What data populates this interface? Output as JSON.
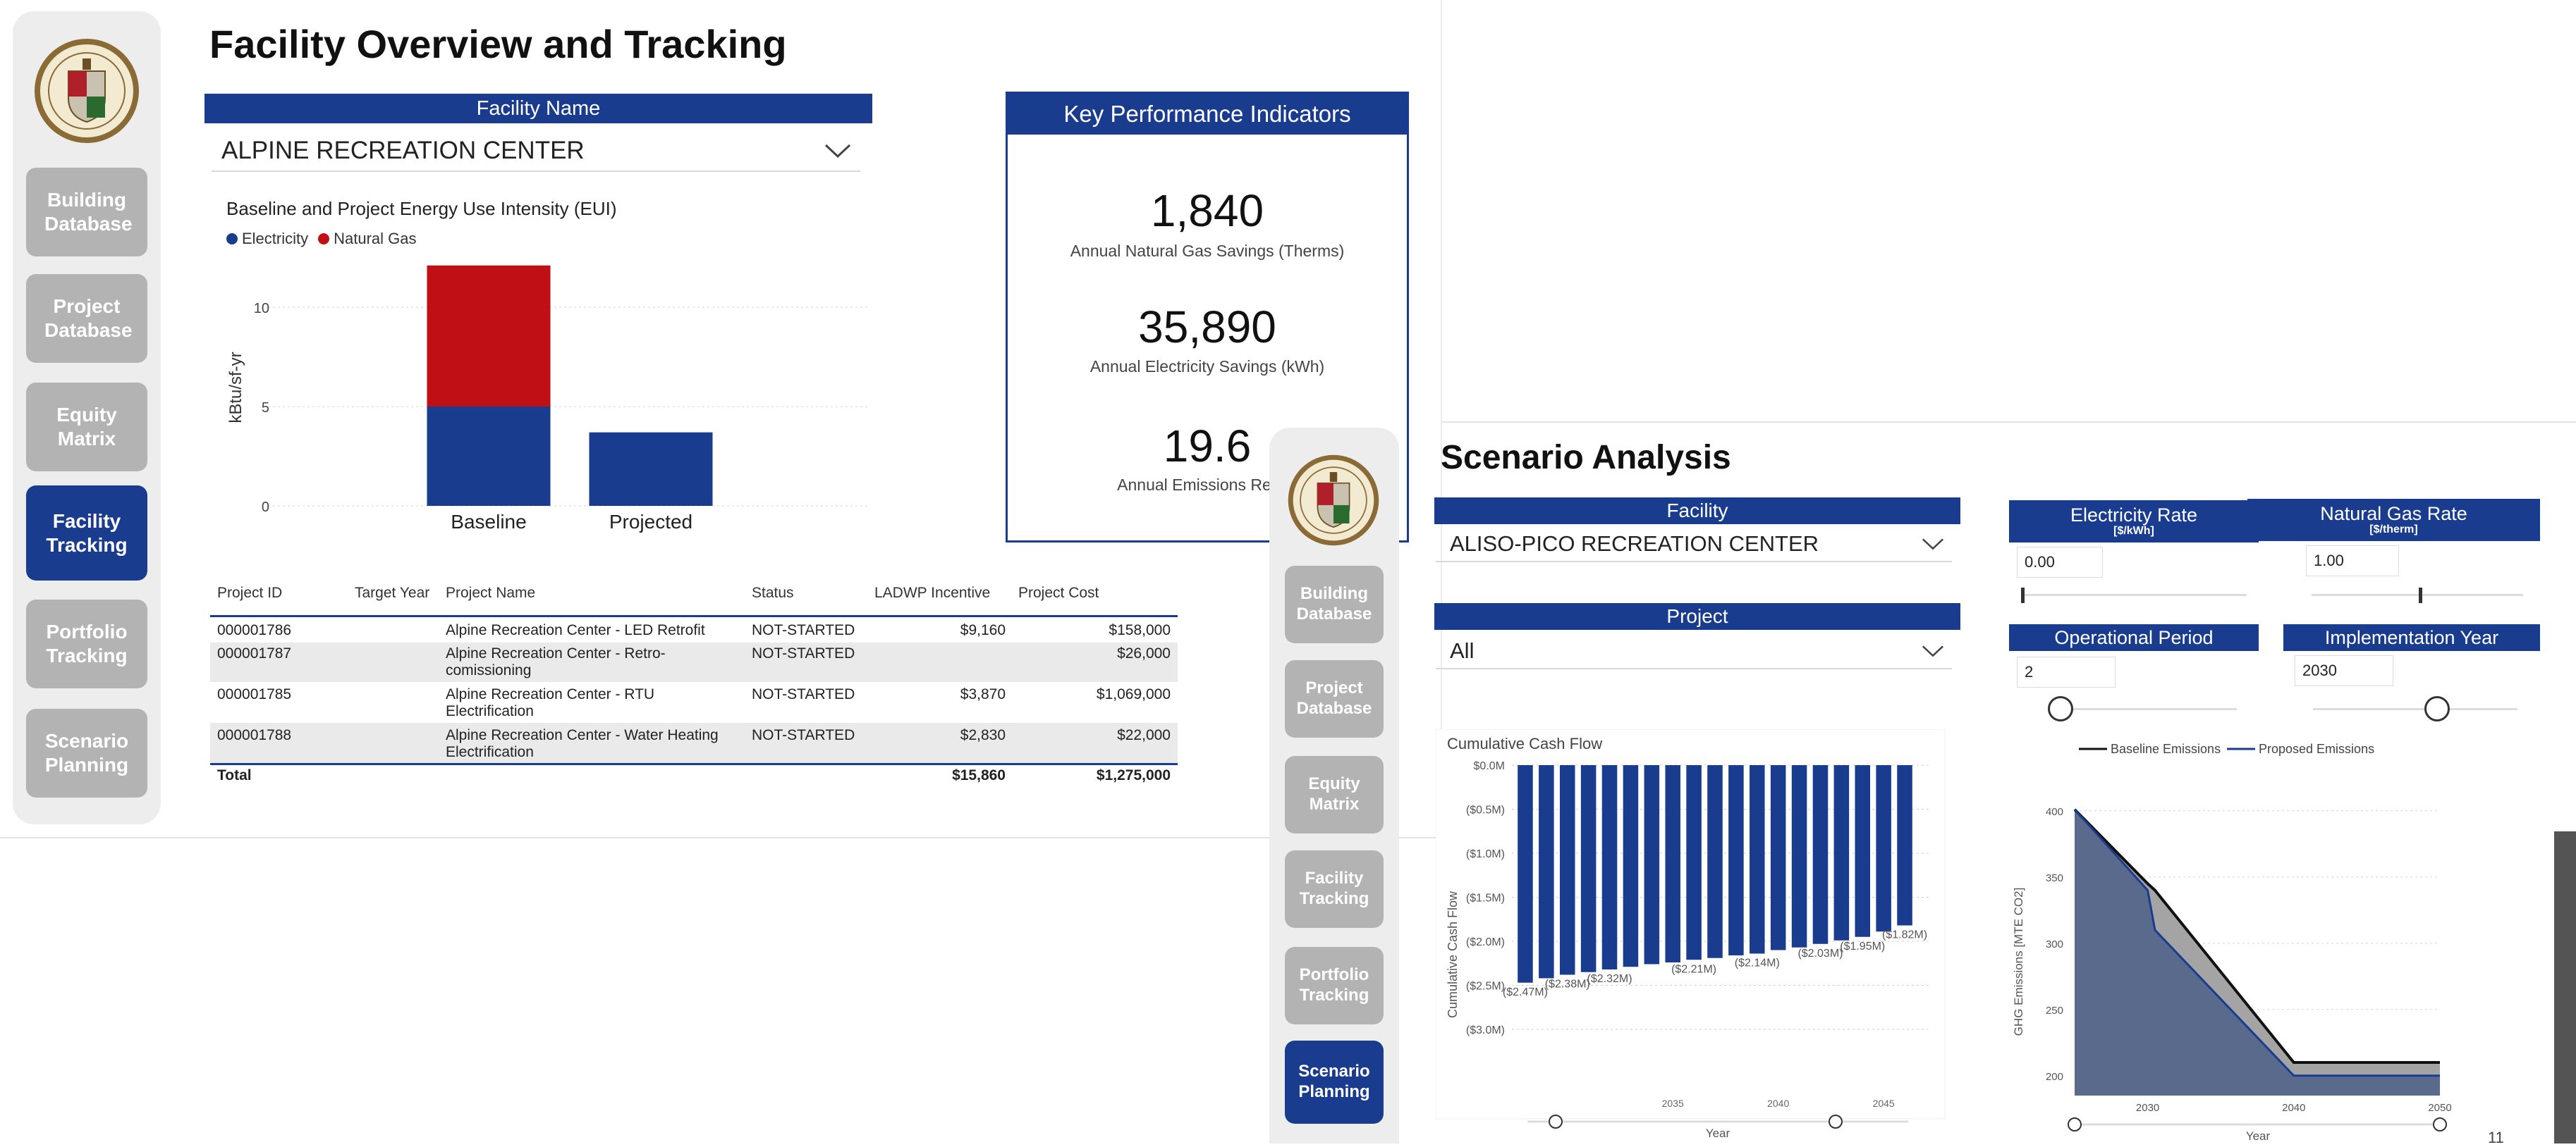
{
  "left": {
    "title": "Facility Overview and Tracking",
    "nav": [
      "Building Database",
      "Project Database",
      "Equity Matrix",
      "Facility Tracking",
      "Portfolio Tracking",
      "Scenario Planning"
    ],
    "facility_header": "Facility Name",
    "facility_value": "ALPINE RECREATION CENTER",
    "eui": {
      "title": "Baseline and Project Energy Use Intensity (EUI)",
      "legend": [
        "Electricity",
        "Natural Gas"
      ],
      "ylabel": "kBtu/sf-yr",
      "yticks": [
        "10",
        "5",
        "0"
      ]
    },
    "kpi": {
      "header": "Key Performance Indicators",
      "items": [
        {
          "value": "1,840",
          "label": "Annual Natural Gas Savings (Therms)"
        },
        {
          "value": "35,890",
          "label": "Annual Electricity Savings (kWh)"
        },
        {
          "value": "19.6",
          "label": "Annual Emissions Reduc"
        }
      ]
    },
    "table": {
      "headers": [
        "Project ID",
        "Target Year",
        "Project Name",
        "Status",
        "LADWP Incentive",
        "Project Cost"
      ],
      "rows": [
        [
          "000001786",
          "",
          "Alpine Recreation Center - LED Retrofit",
          "NOT-STARTED",
          "$9,160",
          "$158,000"
        ],
        [
          "000001787",
          "",
          "Alpine Recreation Center - Retro-comissioning",
          "NOT-STARTED",
          "",
          "$26,000"
        ],
        [
          "000001785",
          "",
          "Alpine Recreation Center - RTU Electrification",
          "NOT-STARTED",
          "$3,870",
          "$1,069,000"
        ],
        [
          "000001788",
          "",
          "Alpine Recreation Center - Water Heating Electrification",
          "NOT-STARTED",
          "$2,830",
          "$22,000"
        ]
      ],
      "total": {
        "label": "Total",
        "incentive": "$15,860",
        "cost": "$1,275,000"
      }
    }
  },
  "right": {
    "title": "Scenario Analysis",
    "nav": [
      "Building Database",
      "Project Database",
      "Equity Matrix",
      "Facility Tracking",
      "Portfolio Tracking",
      "Scenario Planning"
    ],
    "facility_header": "Facility",
    "facility_value": "ALISO-PICO RECREATION CENTER",
    "project_header": "Project",
    "project_value": "All",
    "electricity_rate": {
      "label": "Electricity Rate",
      "unit": "[$/kWh]",
      "value": "0.00"
    },
    "gas_rate": {
      "label": "Natural Gas Rate",
      "unit": "[$/therm]",
      "value": "1.00"
    },
    "operational_period": {
      "label": "Operational Period",
      "value": "2"
    },
    "implementation_year": {
      "label": "Implementation Year",
      "value": "2030"
    },
    "page_number": "11"
  },
  "colors": {
    "blue": "#1a3c8f",
    "red": "#c00f15",
    "nav_gray": "#b3b3b3",
    "baseline_line": "#111111",
    "emission_fill": "#5a6a8d"
  },
  "chart_data": [
    {
      "type": "bar",
      "title": "Baseline and Project Energy Use Intensity (EUI)",
      "ylabel": "kBtu/sf-yr",
      "categories": [
        "Baseline",
        "Projected"
      ],
      "series": [
        {
          "name": "Electricity",
          "values": [
            5.0,
            3.7
          ]
        },
        {
          "name": "Natural Gas",
          "values": [
            7.1,
            0
          ]
        }
      ],
      "ylim": [
        0,
        12.5
      ],
      "stacked": true
    },
    {
      "type": "bar",
      "title": "Cumulative Cash Flow",
      "xlabel": "Year",
      "ylabel": "Cumulative Cash Flow",
      "yticks": [
        "$0.0M",
        "($0.5M)",
        "($1.0M)",
        "($1.5M)",
        "($2.0M)",
        "($2.5M)",
        "($3.0M)"
      ],
      "xticks": [
        "2035",
        "2040",
        "2045"
      ],
      "values": [
        -2.47,
        -2.42,
        -2.38,
        -2.35,
        -2.32,
        -2.29,
        -2.26,
        -2.24,
        -2.21,
        -2.19,
        -2.16,
        -2.14,
        -2.1,
        -2.07,
        -2.03,
        -1.99,
        -1.95,
        -1.89,
        -1.82
      ],
      "data_labels": [
        "($2.47M)",
        "($2.38M)",
        "($2.32M)",
        "($2.21M)",
        "($2.14M)",
        "($2.03M)",
        "($1.95M)",
        "($1.82M)"
      ],
      "ylim": [
        -3.0,
        0
      ]
    },
    {
      "type": "area",
      "xlabel": "Year",
      "ylabel": "GHG Emissions [MTE CO2]",
      "x": [
        2025,
        2030,
        2030.5,
        2040,
        2050
      ],
      "series": [
        {
          "name": "Baseline Emissions",
          "values": [
            401,
            345,
            340,
            210,
            210
          ]
        },
        {
          "name": "Proposed Emissions",
          "values": [
            401,
            340,
            310,
            200,
            200
          ]
        }
      ],
      "ylim": [
        185,
        410
      ],
      "yticks": [
        200,
        250,
        300,
        350,
        400
      ],
      "xticks": [
        2030,
        2040,
        2050
      ]
    }
  ]
}
